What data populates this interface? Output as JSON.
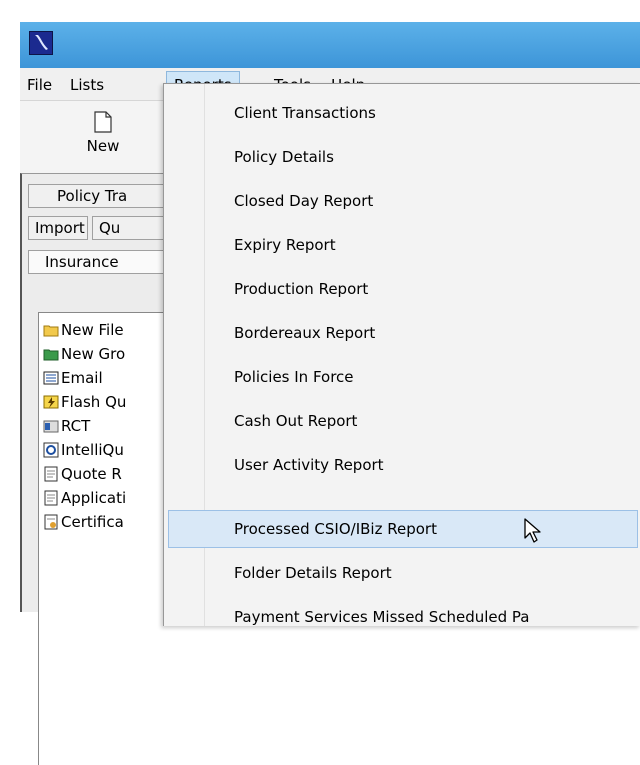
{
  "menubar": {
    "items": [
      "File",
      "Lists",
      "Reports",
      "Tools",
      "Help"
    ]
  },
  "toolbar": {
    "new_label": "New"
  },
  "tabs": {
    "row1": "Policy Tra",
    "row2a": "Import",
    "row2b": "Qu",
    "row3": "Insurance"
  },
  "tree": {
    "items": [
      "New File",
      "New Gro",
      "Email",
      "Flash Qu",
      "RCT",
      "IntelliQu",
      "Quote R",
      "Applicati",
      "Certifica"
    ]
  },
  "reports_menu": {
    "items": [
      "Client Transactions",
      "Policy Details",
      "Closed Day Report",
      "Expiry Report",
      "Production Report",
      "Bordereaux Report",
      "Policies In Force",
      "Cash Out Report",
      "User Activity Report",
      "Processed CSIO/IBiz Report",
      "Folder Details Report",
      "Payment Services Missed Scheduled Pa"
    ],
    "highlighted": "Processed CSIO/IBiz Report"
  },
  "colors": {
    "titlebar": "#4aa3e0",
    "menu_highlight": "#d9e8f7"
  }
}
